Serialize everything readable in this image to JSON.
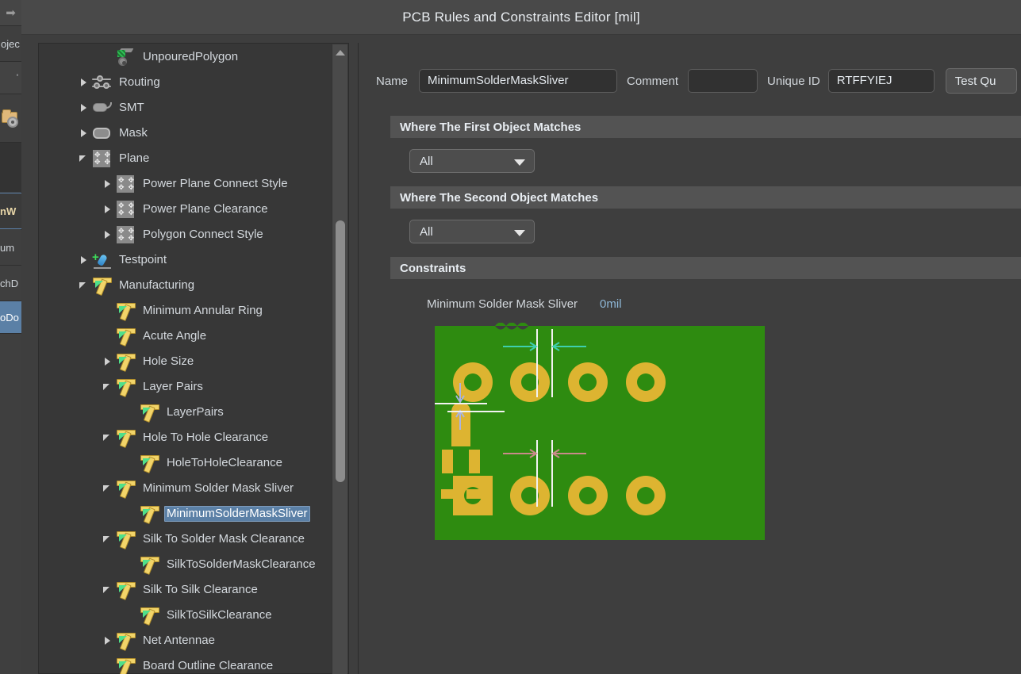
{
  "window": {
    "title": "PCB Rules and Constraints Editor [mil]"
  },
  "left_chrome": {
    "arrow_icon": "arrow-right-icon",
    "project_fragment": "ojec",
    "tick_fragment": "'",
    "folder_icon": "folder-settings-icon",
    "nw_fragment": "nW",
    "um_fragment": "um",
    "chd_fragment": "chD",
    "odo_fragment": "oDo"
  },
  "tree": {
    "items": [
      {
        "label": "UnpouredPolygon",
        "depth": 2,
        "twisty": "none",
        "icon": "polygon-icon"
      },
      {
        "label": "Routing",
        "depth": 1,
        "twisty": "collapsed",
        "icon": "routing-icon"
      },
      {
        "label": "SMT",
        "depth": 1,
        "twisty": "collapsed",
        "icon": "smt-icon"
      },
      {
        "label": "Mask",
        "depth": 1,
        "twisty": "collapsed",
        "icon": "mask-icon"
      },
      {
        "label": "Plane",
        "depth": 1,
        "twisty": "expanded",
        "icon": "plane-icon"
      },
      {
        "label": "Power Plane Connect Style",
        "depth": 2,
        "twisty": "collapsed",
        "icon": "plane-icon"
      },
      {
        "label": "Power Plane Clearance",
        "depth": 2,
        "twisty": "collapsed",
        "icon": "plane-icon"
      },
      {
        "label": "Polygon Connect Style",
        "depth": 2,
        "twisty": "collapsed",
        "icon": "plane-icon"
      },
      {
        "label": "Testpoint",
        "depth": 1,
        "twisty": "collapsed",
        "icon": "testpoint-icon"
      },
      {
        "label": "Manufacturing",
        "depth": 1,
        "twisty": "expanded",
        "icon": "manufacturing-icon"
      },
      {
        "label": "Minimum Annular Ring",
        "depth": 2,
        "twisty": "none",
        "icon": "manufacturing-icon"
      },
      {
        "label": "Acute Angle",
        "depth": 2,
        "twisty": "none",
        "icon": "manufacturing-icon"
      },
      {
        "label": "Hole Size",
        "depth": 2,
        "twisty": "collapsed",
        "icon": "manufacturing-icon"
      },
      {
        "label": "Layer Pairs",
        "depth": 2,
        "twisty": "expanded",
        "icon": "manufacturing-icon"
      },
      {
        "label": "LayerPairs",
        "depth": 3,
        "twisty": "none",
        "icon": "manufacturing-icon"
      },
      {
        "label": "Hole To Hole Clearance",
        "depth": 2,
        "twisty": "expanded",
        "icon": "manufacturing-icon"
      },
      {
        "label": "HoleToHoleClearance",
        "depth": 3,
        "twisty": "none",
        "icon": "manufacturing-icon"
      },
      {
        "label": "Minimum Solder Mask Sliver",
        "depth": 2,
        "twisty": "expanded",
        "icon": "manufacturing-icon"
      },
      {
        "label": "MinimumSolderMaskSliver",
        "depth": 3,
        "twisty": "none",
        "icon": "manufacturing-icon",
        "selected": true
      },
      {
        "label": "Silk To Solder Mask Clearance",
        "depth": 2,
        "twisty": "expanded",
        "icon": "manufacturing-icon"
      },
      {
        "label": "SilkToSolderMaskClearance",
        "depth": 3,
        "twisty": "none",
        "icon": "manufacturing-icon"
      },
      {
        "label": "Silk To Silk Clearance",
        "depth": 2,
        "twisty": "expanded",
        "icon": "manufacturing-icon"
      },
      {
        "label": "SilkToSilkClearance",
        "depth": 3,
        "twisty": "none",
        "icon": "manufacturing-icon"
      },
      {
        "label": "Net Antennae",
        "depth": 2,
        "twisty": "collapsed",
        "icon": "manufacturing-icon"
      },
      {
        "label": "Board Outline Clearance",
        "depth": 2,
        "twisty": "none",
        "icon": "manufacturing-icon"
      }
    ]
  },
  "form": {
    "name_label": "Name",
    "name_value": "MinimumSolderMaskSliver",
    "comment_label": "Comment",
    "comment_value": "",
    "comment_placeholder": "",
    "unique_id_label": "Unique ID",
    "unique_id_value": "RTFFYIEJ",
    "test_query_label": "Test Qu"
  },
  "sections": {
    "first_object": "Where The First Object Matches",
    "second_object": "Where The Second Object Matches",
    "constraints": "Constraints"
  },
  "selectors": {
    "first_scope": "All",
    "second_scope": "All"
  },
  "constraints": {
    "label": "Minimum Solder Mask Sliver",
    "value": "0mil"
  },
  "colors": {
    "board_green": "#2E8B10",
    "pad_gold": "#DDB431",
    "arrow_teal": "#3ecfae",
    "arrow_pink": "#c98a8a",
    "selection_blue": "#5b80a6",
    "accent_value": "#8fb8d8"
  },
  "pcb_illustration": {
    "description": "solder mask sliver illustration",
    "top_arrow_color": "#3ecfae",
    "bottom_arrow_color": "#c98a8a",
    "pads_top": 4,
    "pads_bottom": 4
  }
}
